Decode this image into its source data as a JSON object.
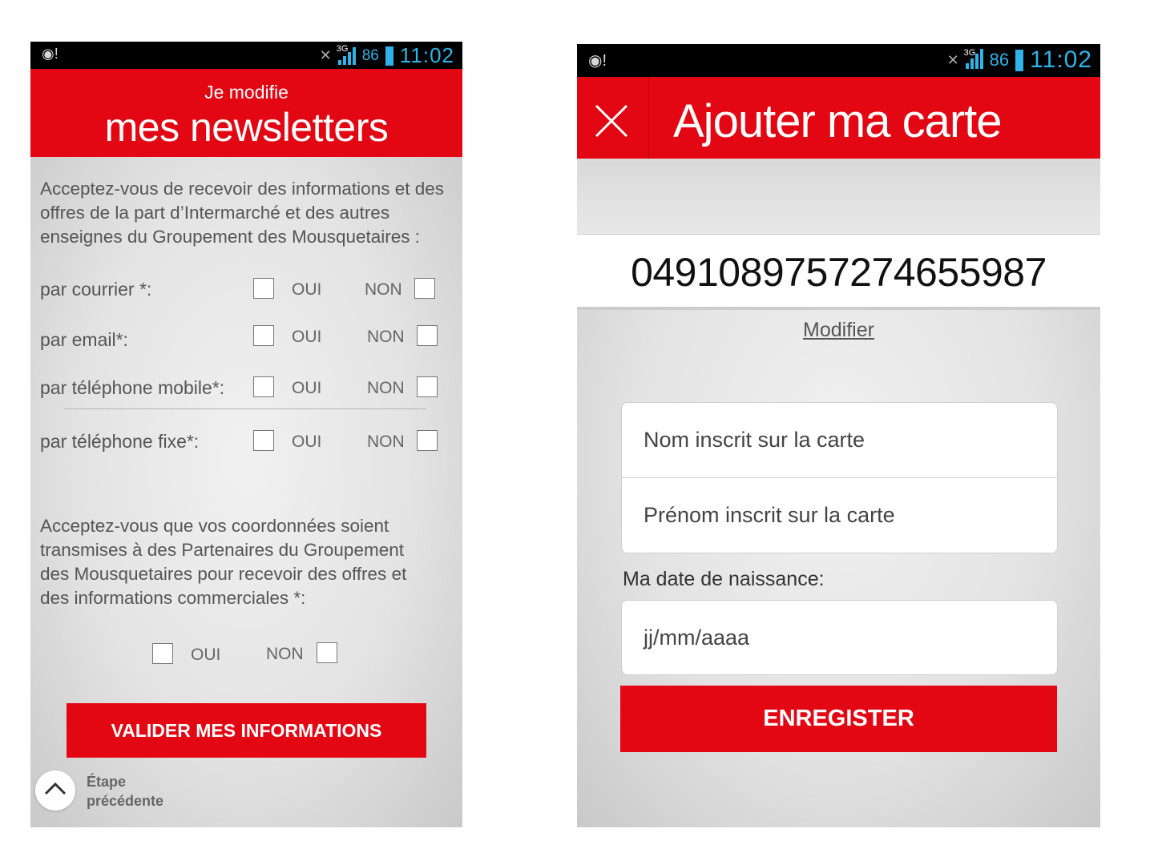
{
  "status_bar": {
    "left_icon": "notification-icon",
    "network": "3G",
    "battery": "86",
    "time": "11:02"
  },
  "newsletter_screen": {
    "header_small": "Je modifie",
    "header_big": "mes newsletters",
    "intro": "Acceptez-vous de recevoir des informations et des offres de la part d’Intermarché et des autres enseignes du Groupement des Mousquetaires :",
    "rows": [
      {
        "label": "par courrier *:",
        "yes": "OUI",
        "no": "NON"
      },
      {
        "label": "par email*:",
        "yes": "OUI",
        "no": "NON"
      },
      {
        "label": "par téléphone mobile*:",
        "yes": "OUI",
        "no": "NON"
      },
      {
        "label": "par téléphone fixe*:",
        "yes": "OUI",
        "no": "NON"
      }
    ],
    "partners_question": "Acceptez-vous que vos coordonnées soient transmises à des  Partenaires du Groupement des Mousquetaires pour recevoir des offres et des informations commerciales *:",
    "partners_yes": "OUI",
    "partners_no": "NON",
    "submit_label": "VALIDER MES INFORMATIONS",
    "back_line1": "Étape",
    "back_line2": "précédente"
  },
  "card_screen": {
    "title": "Ajouter ma carte",
    "card_number": "0491089757274655987",
    "modify_label": "Modifier",
    "last_name_placeholder": "Nom inscrit sur la carte",
    "first_name_placeholder": "Prénom inscrit sur la carte",
    "birthdate_label": "Ma date de naissance:",
    "birthdate_placeholder": "jj/mm/aaaa",
    "save_label": "ENREGISTER"
  },
  "colors": {
    "brand_red": "#e30613",
    "status_blue": "#2fb3e8"
  }
}
